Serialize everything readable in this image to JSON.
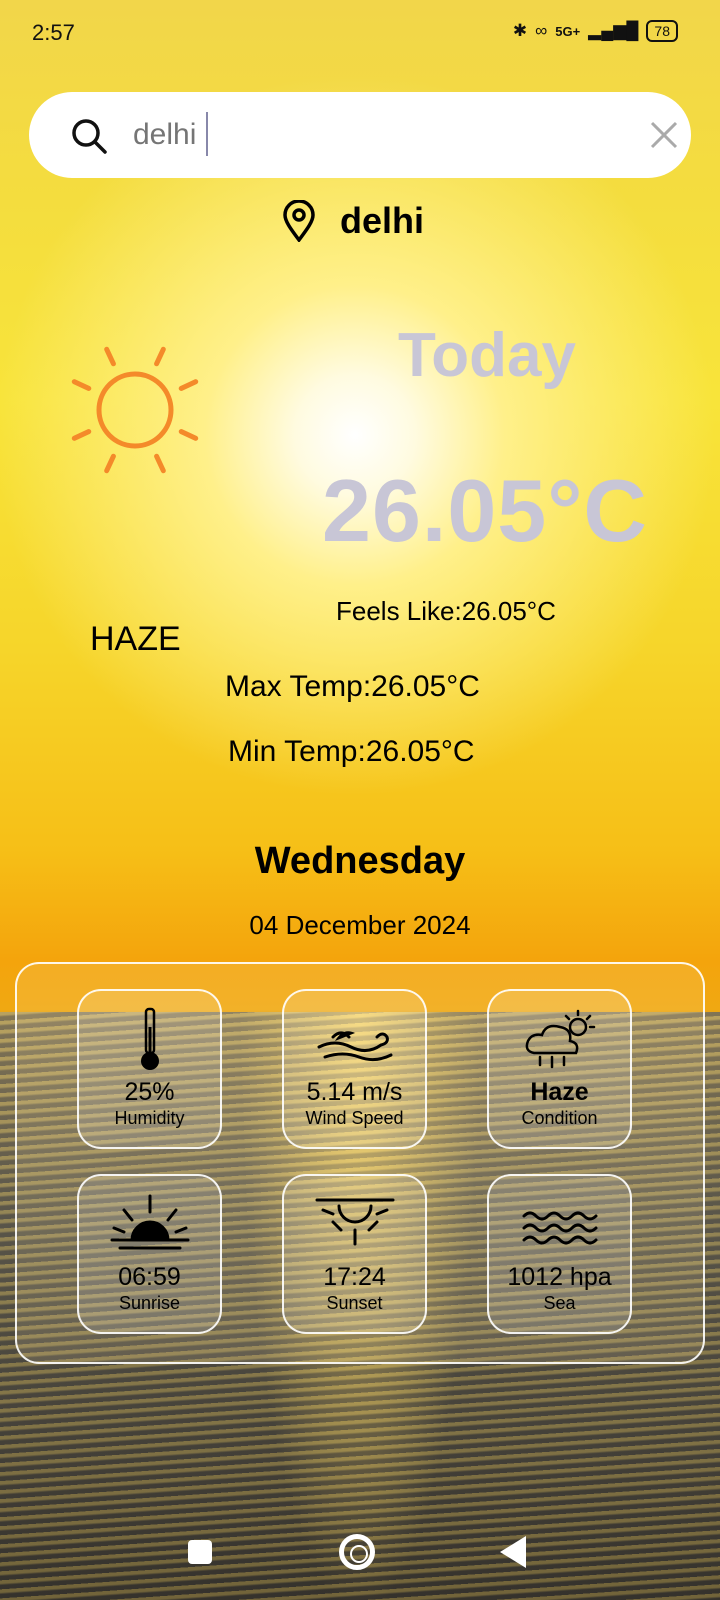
{
  "status_bar": {
    "time": "2:57",
    "network": "5G+",
    "battery": "78"
  },
  "search": {
    "value": "",
    "placeholder": "delhi"
  },
  "location": {
    "name": "delhi"
  },
  "weather": {
    "today_label": "Today",
    "temperature": "26.05°C",
    "feels_like": "Feels Like:26.05°C",
    "condition": "HAZE",
    "max_temp": "Max Temp:26.05°C",
    "min_temp": "Min Temp:26.05°C",
    "day": "Wednesday",
    "date": "04 December 2024",
    "icon": "sun-icon",
    "icon_color": "#f48a2a"
  },
  "details": [
    {
      "value": "25%",
      "label": "Humidity",
      "icon": "thermometer-icon"
    },
    {
      "value": "5.14 m/s",
      "label": "Wind Speed",
      "icon": "wind-icon"
    },
    {
      "value": "Haze",
      "label": "Condition",
      "icon": "cloud-sun-rain-icon"
    },
    {
      "value": "06:59",
      "label": "Sunrise",
      "icon": "sunrise-icon"
    },
    {
      "value": "17:24",
      "label": "Sunset",
      "icon": "sunset-icon"
    },
    {
      "value": "1012 hpa",
      "label": "Sea",
      "icon": "waves-icon"
    }
  ]
}
